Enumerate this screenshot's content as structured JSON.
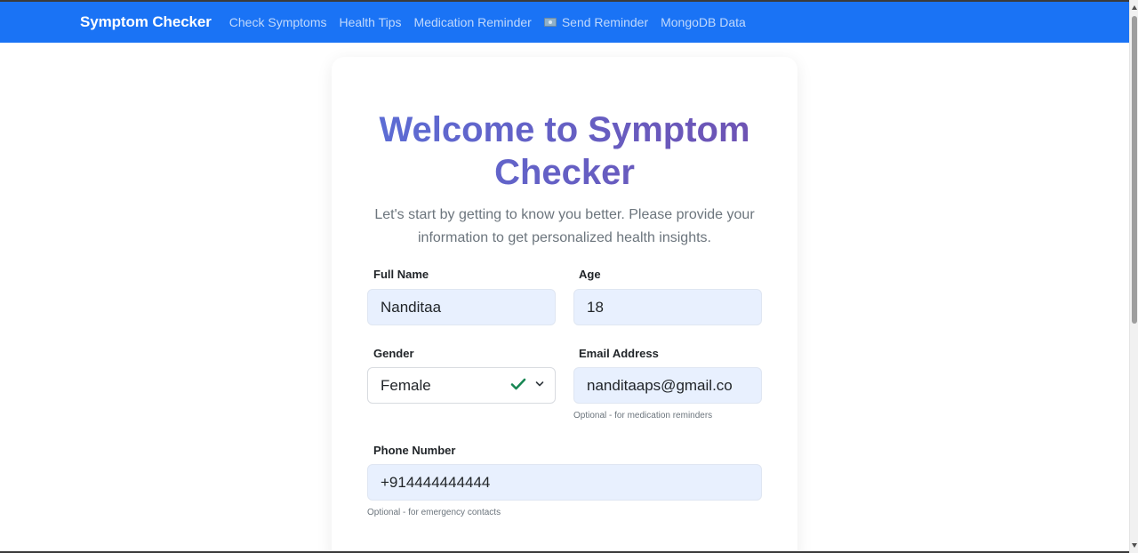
{
  "navbar": {
    "brand": "Symptom Checker",
    "links": [
      "Check Symptoms",
      "Health Tips",
      "Medication Reminder",
      "Send Reminder",
      "MongoDB Data"
    ]
  },
  "page": {
    "title": "Welcome to Symptom Checker",
    "subtitle": "Let's start by getting to know you better. Please provide your information to get personalized health insights."
  },
  "form": {
    "full_name": {
      "label": "Full Name",
      "value": "Nanditaa"
    },
    "age": {
      "label": "Age",
      "value": "18"
    },
    "gender": {
      "label": "Gender",
      "value": "Female"
    },
    "email": {
      "label": "Email Address",
      "value": "nanditaaps@gmail.co",
      "hint": "Optional - for medication reminders"
    },
    "phone": {
      "label": "Phone Number",
      "value": "+914444444444",
      "hint": "Optional - for emergency contacts"
    }
  },
  "colors": {
    "navbar": "#1a73f5",
    "title_gradient_start": "#5a6fd8",
    "title_gradient_end": "#7050b0",
    "valid_check": "#198754"
  }
}
